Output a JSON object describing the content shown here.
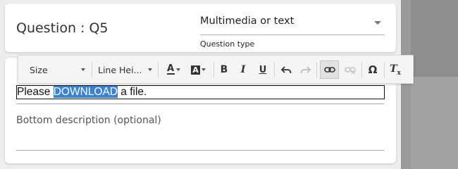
{
  "question": {
    "title": "Question : Q5",
    "type_value": "Multimedia or text",
    "type_label": "Question type"
  },
  "toolbar": {
    "size_label": "Size",
    "line_height_label": "Line Hei..."
  },
  "editor": {
    "text_before": "Please ",
    "highlighted": "DOWNLOAD",
    "text_after": " a file."
  },
  "bottom_description": {
    "placeholder": "Bottom description (optional)"
  }
}
